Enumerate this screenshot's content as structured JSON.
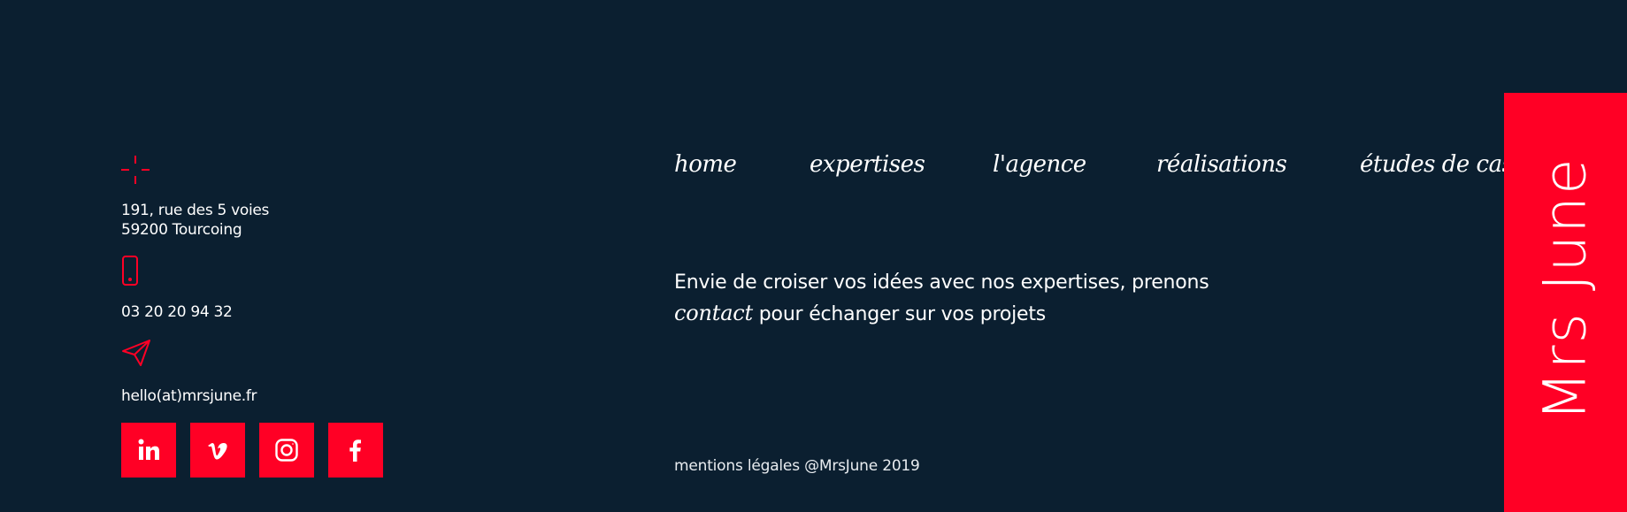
{
  "colors": {
    "background": "#0b1f30",
    "accent": "#ff0025",
    "text": "#ffffff"
  },
  "contact": {
    "address_icon": "crosshair-location-icon",
    "address_line1": "191, rue des 5 voies",
    "address_line2": "59200 Tourcoing",
    "phone_icon": "smartphone-icon",
    "phone": "03 20 20 94 32",
    "email_icon": "paper-plane-icon",
    "email": "hello(at)mrsjune.fr",
    "socials": [
      {
        "icon": "linkedin-icon"
      },
      {
        "icon": "vimeo-icon"
      },
      {
        "icon": "instagram-icon"
      },
      {
        "icon": "facebook-icon"
      }
    ]
  },
  "nav": {
    "home": "home",
    "expertises": "expertises",
    "agence": "l'agence",
    "realisations": "réalisations",
    "etudes": "études de cas"
  },
  "tagline": {
    "line1": "Envie de croiser vos idées avec nos expertises, prenons",
    "contact_link": "contact",
    "line2_rest": " pour échanger sur vos projets"
  },
  "footer": {
    "legal_link": "mentions légales",
    "copyright": " @MrsJune 2019"
  },
  "brand": {
    "name": "Mrs June"
  }
}
